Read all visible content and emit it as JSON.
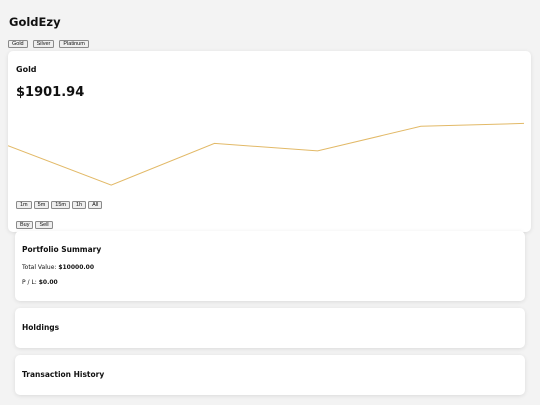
{
  "app": {
    "title": "GoldEzy"
  },
  "metal_tabs": [
    "Gold",
    "Silver",
    "Platinum"
  ],
  "selected_metal": {
    "name": "Gold",
    "price": "$1901.94"
  },
  "chart_data": {
    "type": "line",
    "x": [
      0,
      1,
      2,
      3,
      4,
      5
    ],
    "values": [
      1900.6,
      1895.3,
      1900.9,
      1899.9,
      1903.2,
      1903.6
    ],
    "ylim": [
      1893.7,
      1905.8
    ],
    "grid": false,
    "color": "#e2b967"
  },
  "range_buttons": [
    "1m",
    "5m",
    "15m",
    "1h",
    "All"
  ],
  "trade_buttons": {
    "buy": "Buy",
    "sell": "Sell"
  },
  "portfolio": {
    "title": "Portfolio Summary",
    "total_label": "Total Value: ",
    "total_value": "$10000.00",
    "pl_label": "P / L: ",
    "pl_value": "$0.00"
  },
  "holdings": {
    "title": "Holdings"
  },
  "history": {
    "title": "Transaction History"
  }
}
